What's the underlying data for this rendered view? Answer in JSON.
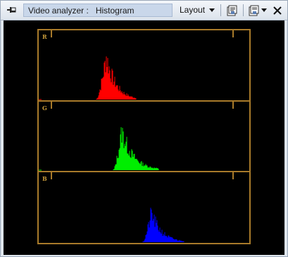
{
  "titlebar": {
    "panel_title": "Video analyzer :   Histogram",
    "layout_label": "Layout"
  },
  "icons": {
    "pin": "pin-icon",
    "properties": "properties-icon",
    "properties_menu": "properties-dropdown-icon",
    "close": "close-icon"
  },
  "histogram": {
    "channels": [
      {
        "label": "R",
        "color": "#ff0000"
      },
      {
        "label": "G",
        "color": "#00ee00"
      },
      {
        "label": "B",
        "color": "#0000ff"
      }
    ]
  }
}
